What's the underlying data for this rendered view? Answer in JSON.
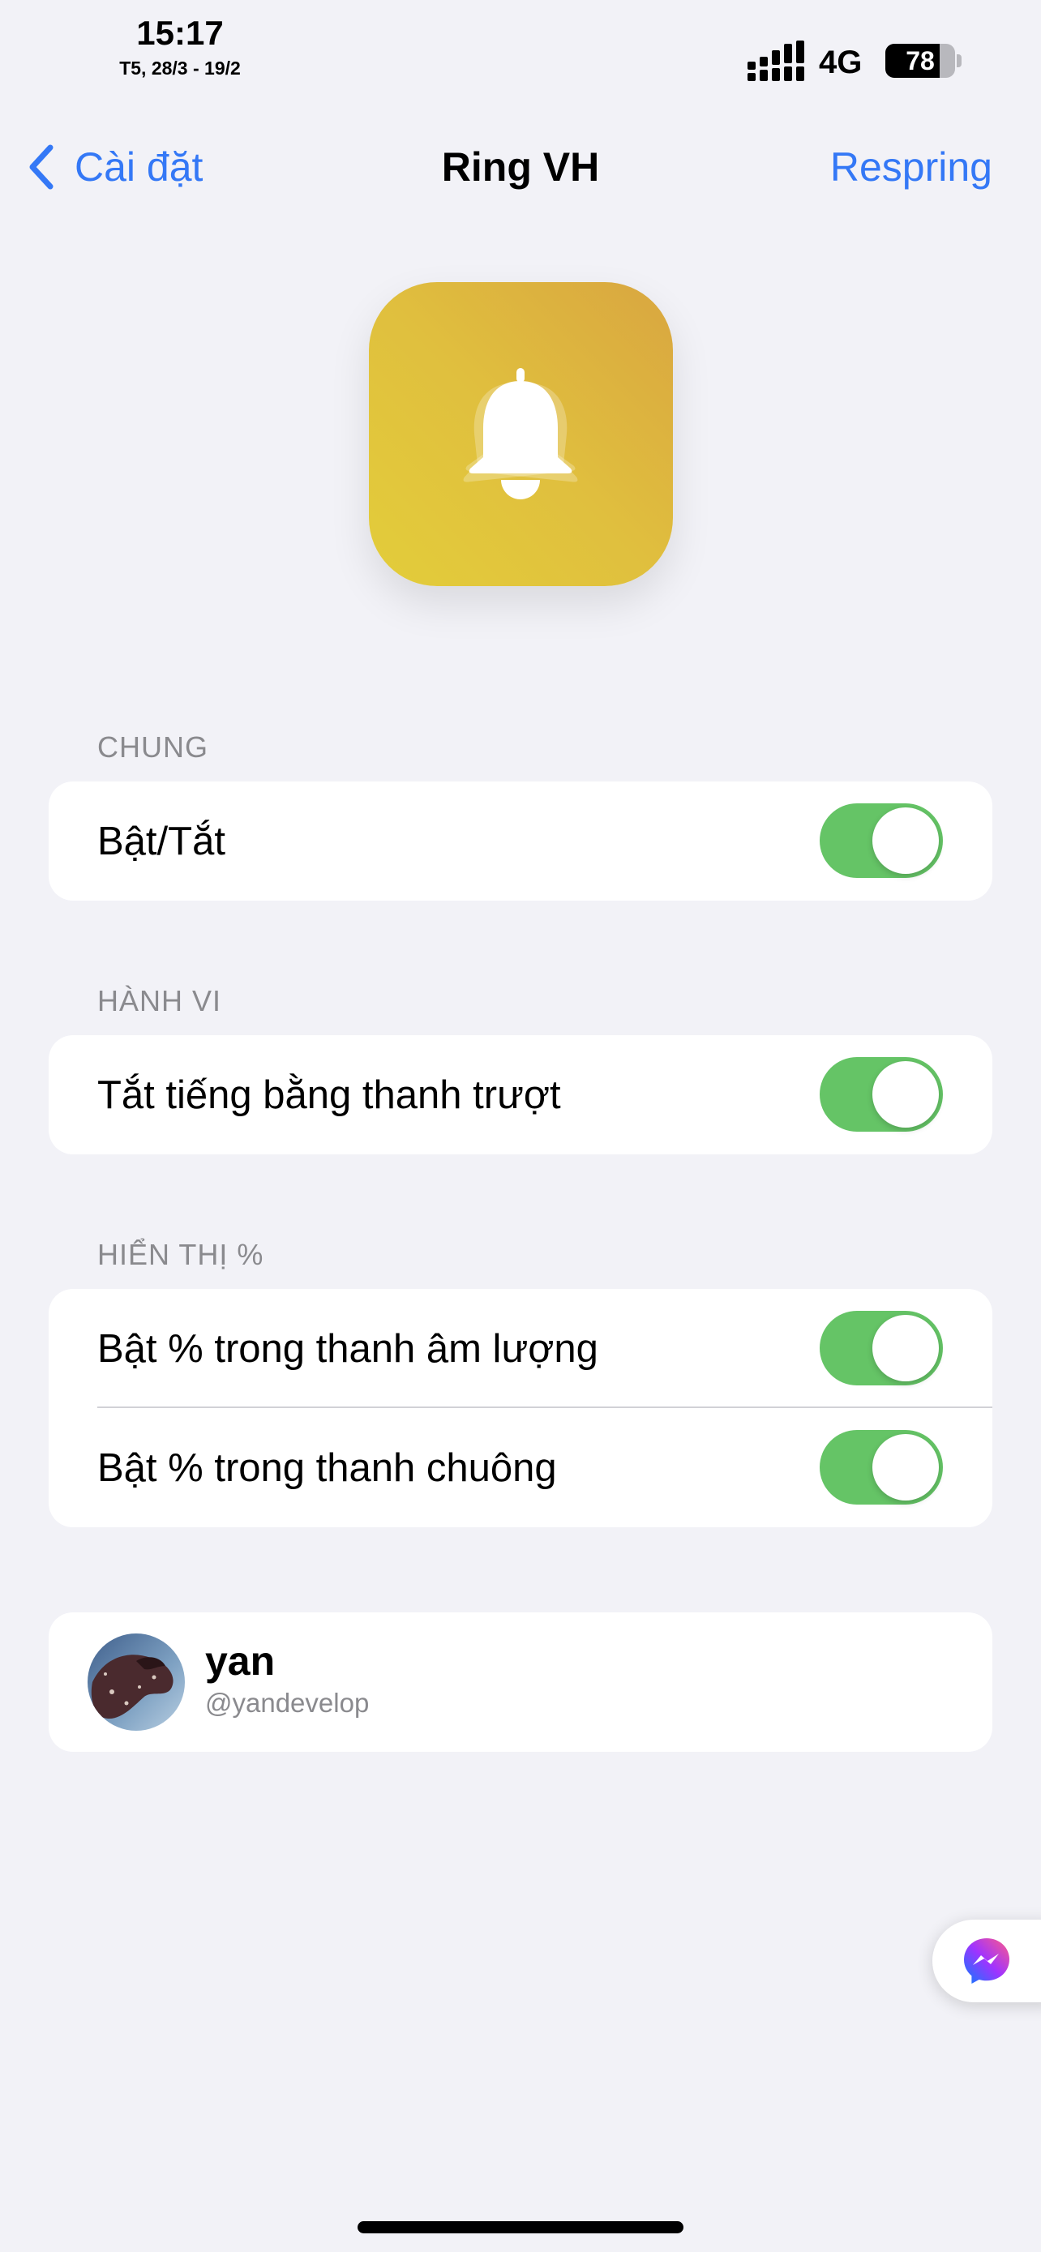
{
  "status_bar": {
    "time": "15:17",
    "date": "T5, 28/3 - 19/2",
    "network": "4G",
    "battery": "78",
    "battery_level": 0.78
  },
  "nav": {
    "back_label": "Cài đặt",
    "title": "Ring VH",
    "action_label": "Respring"
  },
  "icons": {
    "app": "bell-icon",
    "back": "chevron-left-icon",
    "float": "messenger-icon"
  },
  "colors": {
    "accent": "#3478f6",
    "toggle_on": "#65c466",
    "background": "#f2f2f7",
    "icon_gradient": [
      "#d9a640",
      "#e3cd3a"
    ]
  },
  "sections": [
    {
      "header": "CHUNG",
      "rows": [
        {
          "label": "Bật/Tắt",
          "toggle": true
        }
      ]
    },
    {
      "header": "HÀNH VI",
      "rows": [
        {
          "label": "Tắt tiếng bằng thanh trượt",
          "toggle": true
        }
      ]
    },
    {
      "header": "HIỂN THỊ %",
      "rows": [
        {
          "label": "Bật % trong thanh âm lượng",
          "toggle": true
        },
        {
          "label": "Bật % trong thanh chuông",
          "toggle": true
        }
      ]
    }
  ],
  "credit": {
    "name": "yan",
    "handle": "@yandevelop"
  }
}
